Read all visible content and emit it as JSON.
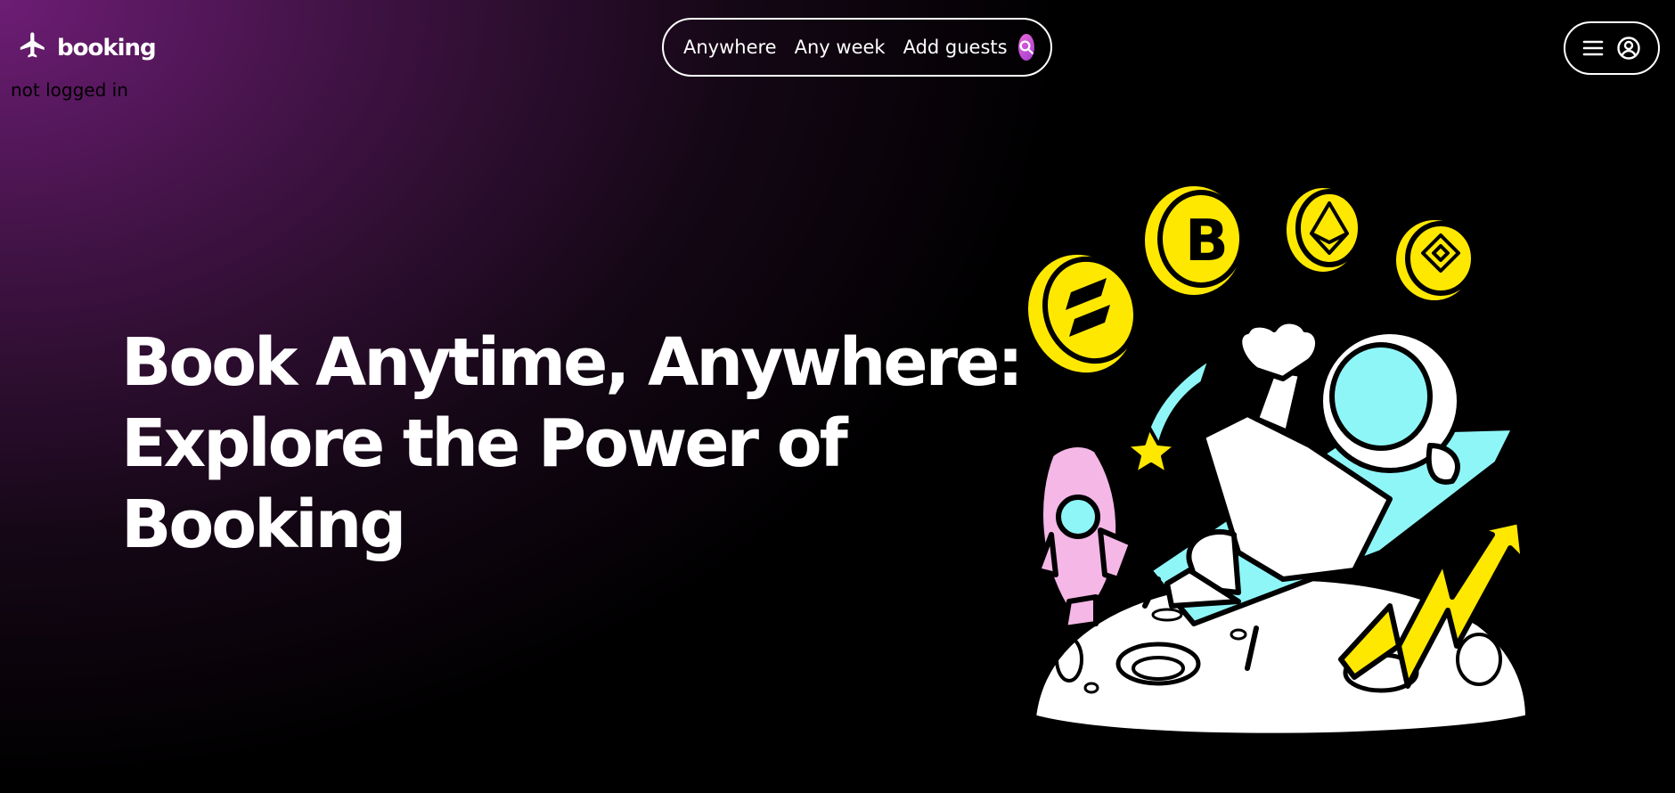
{
  "header": {
    "logo_text": "booking",
    "login_status": "not logged in"
  },
  "search": {
    "location": "Anywhere",
    "week": "Any week",
    "guests": "Add guests"
  },
  "hero": {
    "title_lines": [
      "Book Anytime, Anywhere:",
      "Explore the Power of",
      "Booking"
    ]
  },
  "icons": {
    "logo": "airplane-icon",
    "search": "search-icon",
    "menu": "hamburger-menu-icon",
    "user": "user-circle-icon"
  },
  "colors": {
    "gradient_accent": "#6d1d75",
    "coin_yellow": "#ffe800",
    "astronaut_cyan": "#8ff6f8",
    "rocket_pink": "#f4b7e6",
    "search_button": "#c254d6"
  }
}
